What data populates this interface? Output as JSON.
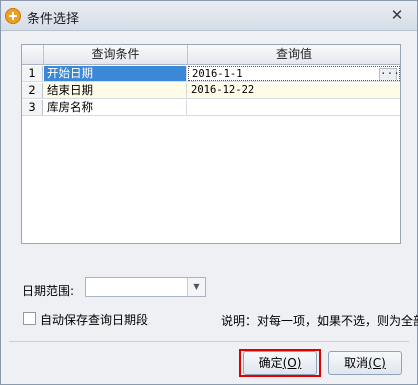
{
  "window": {
    "title": "条件选择",
    "close_symbol": "✕"
  },
  "grid": {
    "columns": [
      "查询条件",
      "查询值"
    ],
    "rows": [
      {
        "num": "1",
        "condition": "开始日期",
        "value": "2016-1-1",
        "selected": true
      },
      {
        "num": "2",
        "condition": "结束日期",
        "value": "2016-12-22"
      },
      {
        "num": "3",
        "condition": "库房名称",
        "value": ""
      }
    ],
    "ellipsis": "···"
  },
  "date_range": {
    "label": "日期范围:",
    "value": ""
  },
  "autosave": {
    "label": "自动保存查询日期段",
    "checked": false
  },
  "note": "说明：对每一项，如果不选，则为全部！",
  "buttons": {
    "ok_label": "确定",
    "ok_hotkey": "(O)",
    "cancel_label": "取消",
    "cancel_hotkey": "(C)"
  },
  "colors": {
    "selection": "#3b87d8",
    "highlight_box": "#e00000",
    "app_icon": "#f0a020"
  },
  "icons": {
    "app": "app-logo-icon",
    "close": "close-icon",
    "dropdown": "chevron-down-icon",
    "ellipsis": "ellipsis-icon"
  }
}
